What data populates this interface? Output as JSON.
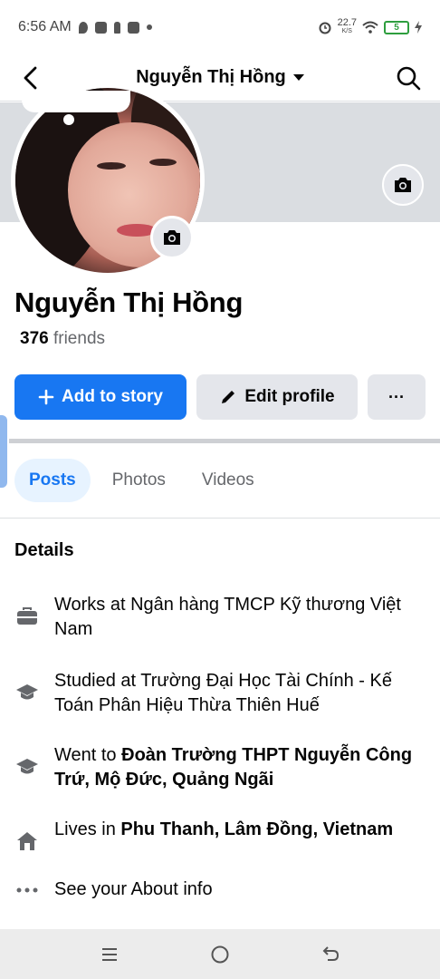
{
  "status_bar": {
    "time": "6:56 AM",
    "speed_value": "22.7",
    "speed_unit": "K/S",
    "battery": "5"
  },
  "header": {
    "title": "Nguyễn Thị Hồng"
  },
  "profile": {
    "name": "Nguyễn Thị Hồng",
    "friends_count": "376",
    "friends_label": "friends"
  },
  "actions": {
    "add_story": "Add to story",
    "edit_profile": "Edit profile",
    "more": "···"
  },
  "tabs": [
    {
      "label": "Posts",
      "active": true
    },
    {
      "label": "Photos",
      "active": false
    },
    {
      "label": "Videos",
      "active": false
    }
  ],
  "details": {
    "title": "Details",
    "items": [
      {
        "icon": "briefcase-icon",
        "prefix": "Works at Ngân hàng TMCP Kỹ thương Việt Nam",
        "bold": ""
      },
      {
        "icon": "graduation-cap-icon",
        "prefix": "Studied at Trường Đại Học Tài Chính - Kế Toán Phân Hiệu Thừa Thiên Huế",
        "bold": ""
      },
      {
        "icon": "graduation-cap-icon",
        "prefix": "Went to ",
        "bold": "Đoàn Trường THPT Nguyễn Công Trứ, Mộ Đức, Quảng Ngãi"
      },
      {
        "icon": "home-icon",
        "prefix": "Lives in ",
        "bold": "Phu Thanh, Lâm Đồng, Vietnam"
      },
      {
        "icon": "more-dots-icon",
        "prefix": "See your About info",
        "bold": ""
      }
    ]
  },
  "colors": {
    "primary": "#1877f2",
    "tab_active_bg": "#e7f3ff",
    "cover": "#dadde1"
  }
}
